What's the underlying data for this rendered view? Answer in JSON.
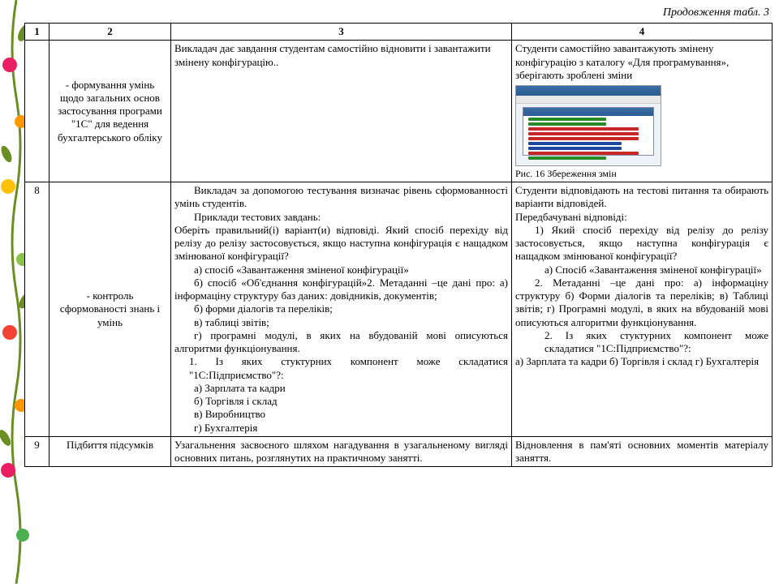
{
  "caption": "Продовження табл. 3",
  "headers": {
    "c1": "1",
    "c2": "2",
    "c3": "3",
    "c4": "4"
  },
  "row_top": {
    "col2": "- формування умінь щодо загальних основ застосування програми \"1С\" для ведення бухгалтерського обліку",
    "col3": "Викладач дає завдання студентам самостійно відновити і завантажити змінену конфігурацію..",
    "col4": "Студенти самостійно завантажують змінену конфігурацію з каталогу «Для програмування», зберігають зроблені зміни",
    "figure": "Рис. 16 Збереження змін"
  },
  "row8": {
    "num": "8",
    "col2": "- контроль сформованості знань і умінь",
    "col3_p1": "Викладач за допомогою тестування визначає рівень сформованності умінь студентів.",
    "col3_p2": "Приклади тестових завдань:",
    "col3_p3": "Оберіть правильний(і) варіант(и) відповіді. Який спосіб перехіду від релізу до релізу застосовується, якщо наступна конфігурація є нащадком змінюваної конфігурації?",
    "col3_a": "а) спосіб «Завантаження зміненої конфігурації»",
    "col3_b": "б) спосіб «Об'єднання конфігурацій»2. Метаданні –це дані про: а) інформаціну структуру баз даних: довідників, документів;",
    "col3_b2": "б) форми діалогів та переліків;",
    "col3_b3": "в) таблиці звітів;",
    "col3_b4": "г) програмні модулі, в яких на вбудованій мові описуються алгоритми функціонування.",
    "col3_q1": "1. Із яких стуктурних компонент може складатися \"1С:Підприємство\"?:",
    "col3_q1a": "а) Зарплата та кадри",
    "col3_q1b": "б) Торгівля і склад",
    "col3_q1c": "в) Виробництво",
    "col3_q1d": "г) Бухгалтерія",
    "col4_p1": "Студенти відповідають на тестові питання та обирають варіанти відповідей.",
    "col4_p2": "Передбачувані відповіді:",
    "col4_p3": "1) Який спосіб перехіду від релізу до релізу застосовується, якщо наступна конфігурація є нащадком змінюваної конфігурації?",
    "col4_a": "а) Спосіб «Завантаження зміненої конфігурації»",
    "col4_p4": "2. Метаданні –це дані про: а) інформаціну структуру б) Форми діалогів та переліків; в) Таблиці звітів; г) Програмні модулі, в яких на вбудованій мові описуються алгоритми функціонування.",
    "col4_q2": "2. Із яких стуктурних компонент може складатися \"1С:Підприємство\"?:",
    "col4_q2a": "а) Зарплата та кадри б) Торгівля і склад г) Бухгалтерія"
  },
  "row9": {
    "num": "9",
    "col2": "Підбиття підсумків",
    "col3": "Узагальнення засвоєного шляхом нагадування в узагальненому вигляді основних питань, розглянутих на практичному занятті.",
    "col4": "Відновлення в пам'яті основних моментів матеріалу заняття."
  }
}
